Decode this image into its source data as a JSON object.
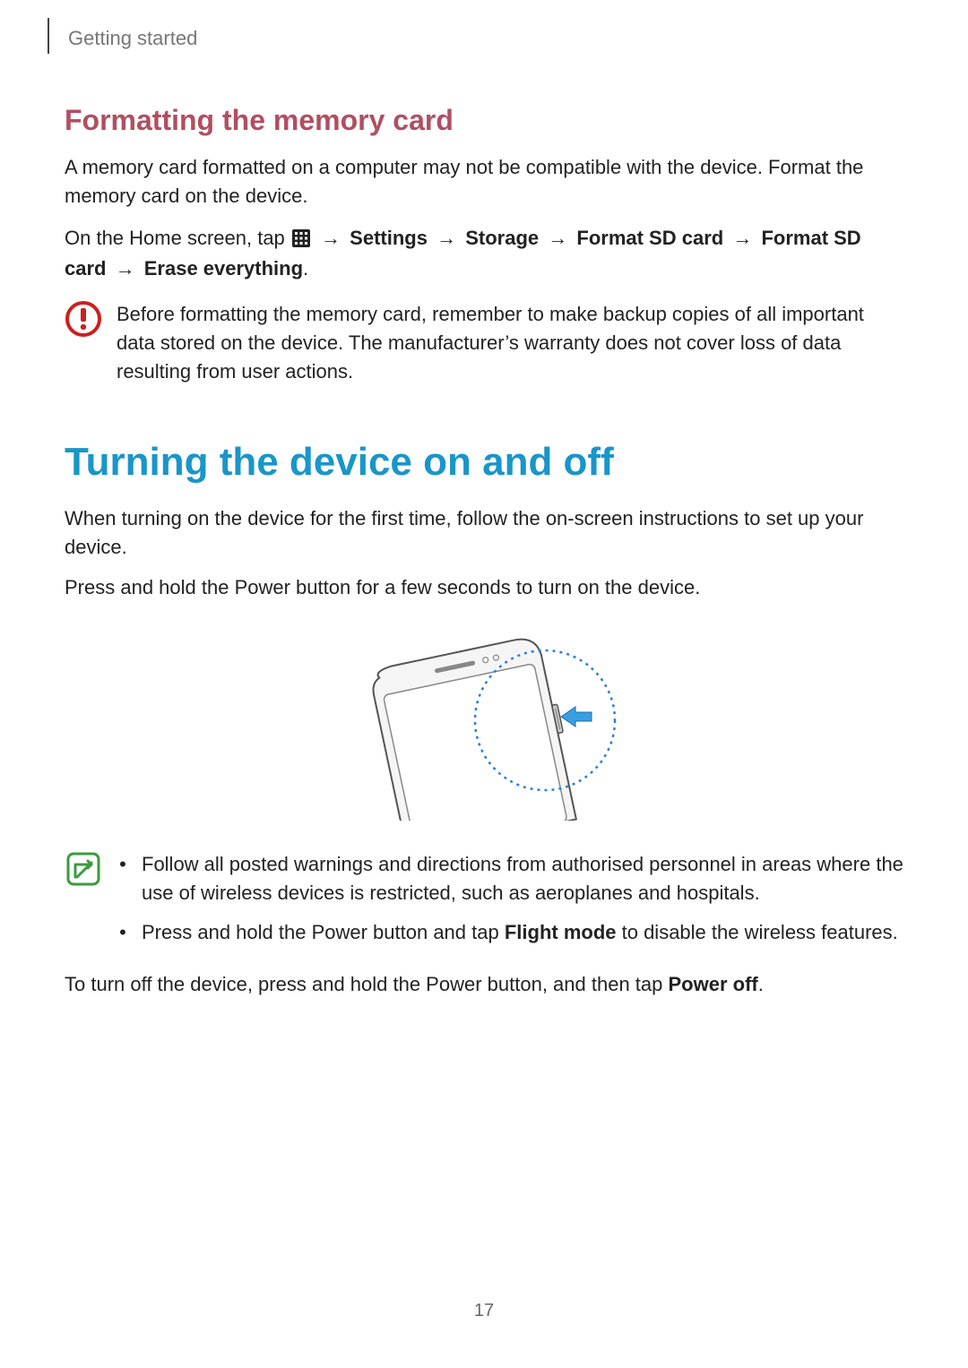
{
  "breadcrumb": "Getting started",
  "heading_formatting": "Formatting the memory card",
  "para_format_intro": "A memory card formatted on a computer may not be compatible with the device. Format the memory card on the device.",
  "nav_path": {
    "prefix": "On the Home screen, tap ",
    "steps": [
      "Settings",
      "Storage",
      "Format SD card",
      "Format SD card",
      "Erase everything"
    ],
    "arrow": "→",
    "suffix": "."
  },
  "caution_text": "Before formatting the memory card, remember to make backup copies of all important data stored on the device. The manufacturer’s warranty does not cover loss of data resulting from user actions.",
  "heading_turning": "Turning the device on and off",
  "para_turning_intro": "When turning on the device for the first time, follow the on-screen instructions to set up your device.",
  "para_turning_power": "Press and hold the Power button for a few seconds to turn on the device.",
  "note_items": [
    {
      "pre": "Follow all posted warnings and directions from authorised personnel in areas where the use of wireless devices is restricted, such as aeroplanes and hospitals.",
      "bold": "",
      "post": ""
    },
    {
      "pre": "Press and hold the Power button and tap ",
      "bold": "Flight mode",
      "post": " to disable the wireless features."
    }
  ],
  "para_power_off_pre": "To turn off the device, press and hold the Power button, and then tap ",
  "para_power_off_bold": "Power off",
  "para_power_off_post": ".",
  "page_number": "17"
}
